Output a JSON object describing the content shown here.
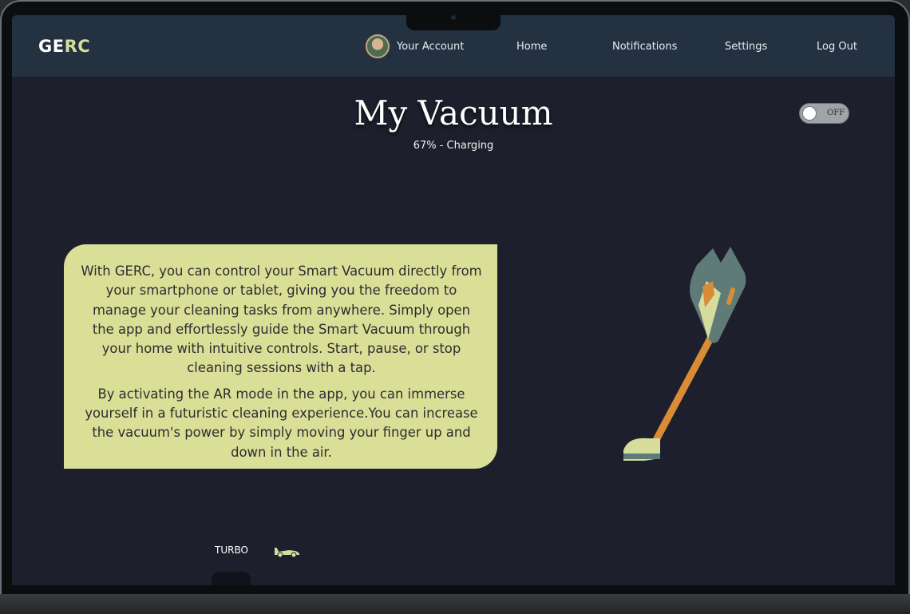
{
  "brand": {
    "part1": "GE",
    "part2": "RC"
  },
  "nav": {
    "account": "Your Account",
    "home": "Home",
    "notifications": "Notifications",
    "settings": "Settings",
    "logout": "Log Out"
  },
  "page": {
    "title": "My Vacuum",
    "status": "67% - Charging"
  },
  "power_toggle": {
    "label": "OFF",
    "state": "off"
  },
  "info": {
    "paragraph1": "With GERC, you can control your Smart Vacuum directly from your smartphone or tablet, giving you the freedom to manage your cleaning tasks from anywhere. Simply open the app and effortlessly guide the Smart Vacuum through your home with intuitive controls. Start, pause, or stop cleaning sessions with a tap.",
    "paragraph2": "By activating the AR mode in the app, you can immerse yourself in a futuristic cleaning experience.You can increase the vacuum's power by simply moving your finger up and down in the air."
  },
  "modes": {
    "turbo_label": "TURBO"
  },
  "icons": {
    "avatar": "user-avatar",
    "vacuum": "stick-vacuum-illustration",
    "turbo": "race-car-icon"
  },
  "colors": {
    "accent": "#dadf97",
    "navbar": "#233141",
    "background": "#1d202c",
    "vacuum_handle": "#d98b35"
  }
}
